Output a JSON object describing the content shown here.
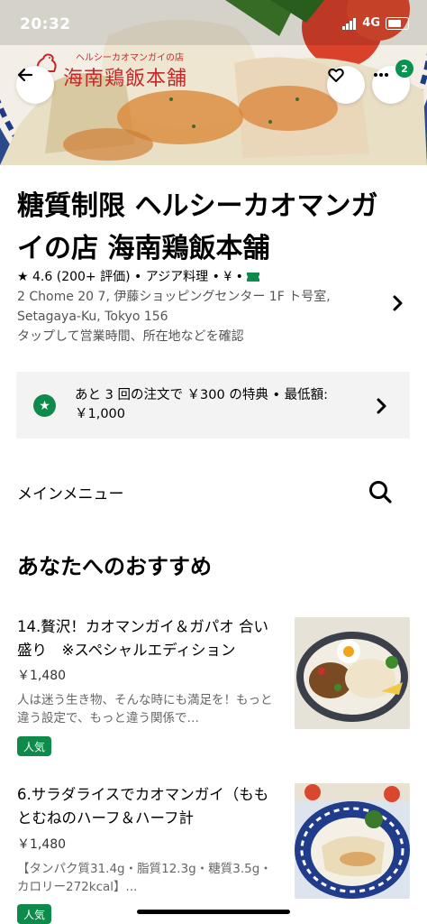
{
  "status": {
    "time": "20:32",
    "network": "4G"
  },
  "header": {
    "logo_sub": "ヘルシーカオマンガイの店",
    "logo_main": "海南鶏飯本舗",
    "badge_count": "2",
    "icons": [
      "back-arrow-icon",
      "heart-icon",
      "more-icon"
    ]
  },
  "restaurant": {
    "title": "糖質制限 ヘルシーカオマンガイの店 海南鶏飯本舗",
    "rating_star": "★",
    "rating": "4.6",
    "reviews": "(200+ 評価)",
    "category": "• アジア料理 • ¥ •",
    "address_line1": "2 Chome 20 7, 伊藤ショッピングセンター 1F ト号室,",
    "address_line2": "Setagaya-Ku, Tokyo 156",
    "info_hint": "タップして営業時間、所在地などを確認"
  },
  "promo": {
    "text": "あと 3 回の注文で ￥300 の特典 • 最低額: ￥1,000"
  },
  "menu": {
    "label": "メインメニュー"
  },
  "section_title": "あなたへのおすすめ",
  "items": [
    {
      "name": "14.贅沢！カオマンガイ＆ガパオ 合い盛り　※スペシャルエディション",
      "price": "￥1,480",
      "desc": "人は迷う生き物、そんな時にも満足を！もっと違う設定で、もっと違う関係で…",
      "tag": "人気"
    },
    {
      "name": "6.サラダライスでカオマンガイ（ももとむねのハーフ＆ハーフ計",
      "price": "￥1,480",
      "desc": "【タンパク質31.4g・脂質12.3g・糖質3.5g・カロリー272kcal】...",
      "tag": "人気"
    }
  ],
  "colors": {
    "accent_green": "#0e8a4a",
    "logo_red": "#c12a2a"
  }
}
